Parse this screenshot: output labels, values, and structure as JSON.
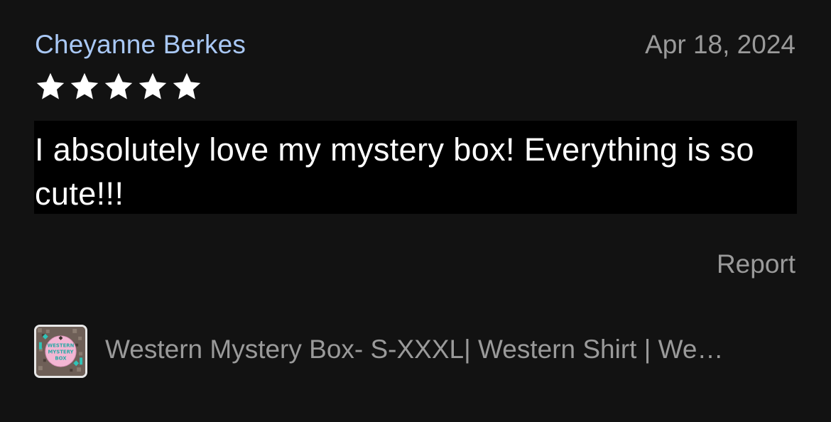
{
  "review": {
    "reviewer_name": "Cheyanne Berkes",
    "date": "Apr 18, 2024",
    "rating": 5,
    "max_rating": 5,
    "text": "I absolutely love my mystery box! Everything is so cute!!!",
    "report_label": "Report",
    "product": {
      "title": "Western Mystery Box- S-XXXL| Western Shirt | We…",
      "thumbnail_icon": "product-thumbnail-image",
      "thumbnail_text": "WESTERN MYSTERY BOX"
    }
  },
  "colors": {
    "background": "#121212",
    "reviewer_name": "#a9c8f5",
    "muted_text": "#9a9a9a",
    "review_text_bg": "#000000",
    "star": "#ffffff"
  }
}
